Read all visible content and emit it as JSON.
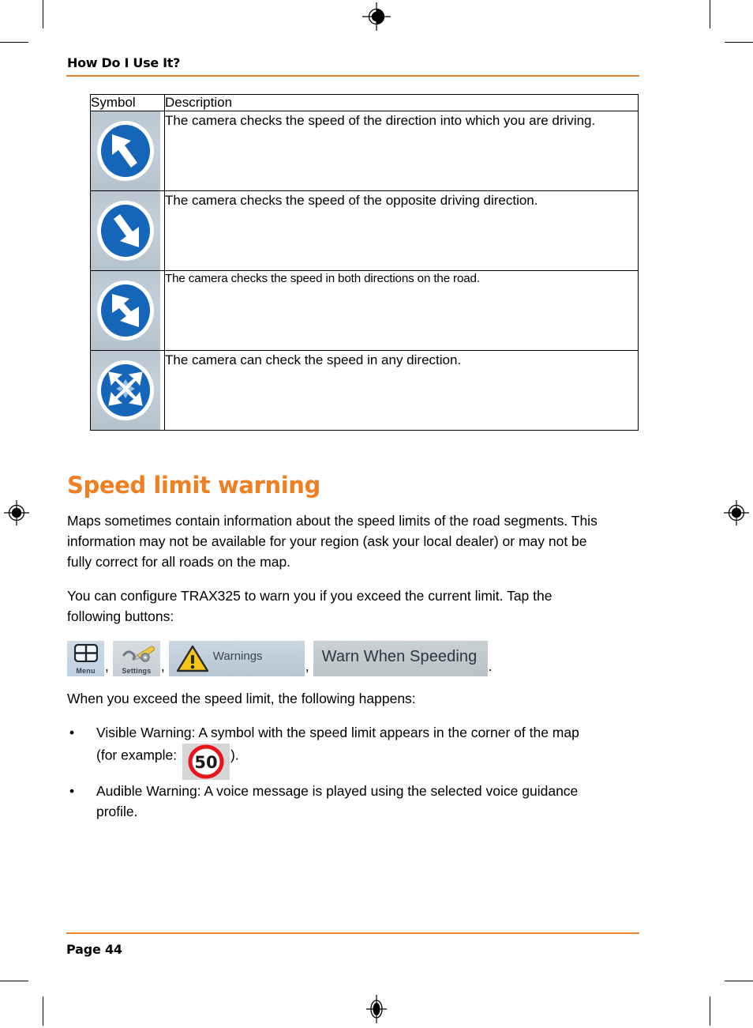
{
  "document": {
    "running_head": "How Do I Use It?",
    "page_label": "Page 44",
    "accent_color": "#e8812b",
    "heading_color": "#ef7f21"
  },
  "symbol_table": {
    "headers": [
      "Symbol",
      "Description"
    ],
    "rows": [
      {
        "icon": "arrow-up-left-icon",
        "description": "The camera checks the speed of the direction into which you are driving."
      },
      {
        "icon": "arrow-down-right-icon",
        "description": "The camera checks the speed of the opposite driving direction."
      },
      {
        "icon": "arrow-bidirectional-diagonal-icon",
        "description": "The camera checks the speed in both directions on the road."
      },
      {
        "icon": "arrow-four-way-icon",
        "description": "The camera can check the speed in any direction."
      }
    ]
  },
  "section": {
    "heading": "Speed limit warning",
    "paragraph_1": "Maps sometimes contain information about the speed limits of the road segments. This information may not be available for your region (ask your local dealer) or may not be fully correct for all roads on the map.",
    "paragraph_2": "You can configure TRAX325 to warn you if you exceed the current limit. Tap the following buttons:",
    "paragraph_3": "When you exceed the speed limit, the following happens:"
  },
  "buttons": {
    "menu": {
      "label": "Menu",
      "icon": "grid-icon"
    },
    "settings": {
      "label": "Settings",
      "icon": "tools-icon"
    },
    "warnings": {
      "label": "Warnings",
      "icon": "warning-triangle-icon"
    },
    "warn_when_speeding": {
      "label": "Warn When Speeding"
    },
    "separator": ",",
    "terminator": "."
  },
  "bullets": [
    {
      "marker": "•",
      "text_before": "Visible Warning: A symbol with the speed limit appears in the corner of the map  (for example:",
      "speed_value": "50",
      "text_after": ")."
    },
    {
      "marker": "•",
      "text_before": "Audible Warning: A voice message is played using the selected voice guidance profile.",
      "speed_value": "",
      "text_after": ""
    }
  ],
  "colors": {
    "sign_blue": "#1565b8",
    "speed_red": "#e8161c",
    "warning_yellow": "#f5c518"
  }
}
